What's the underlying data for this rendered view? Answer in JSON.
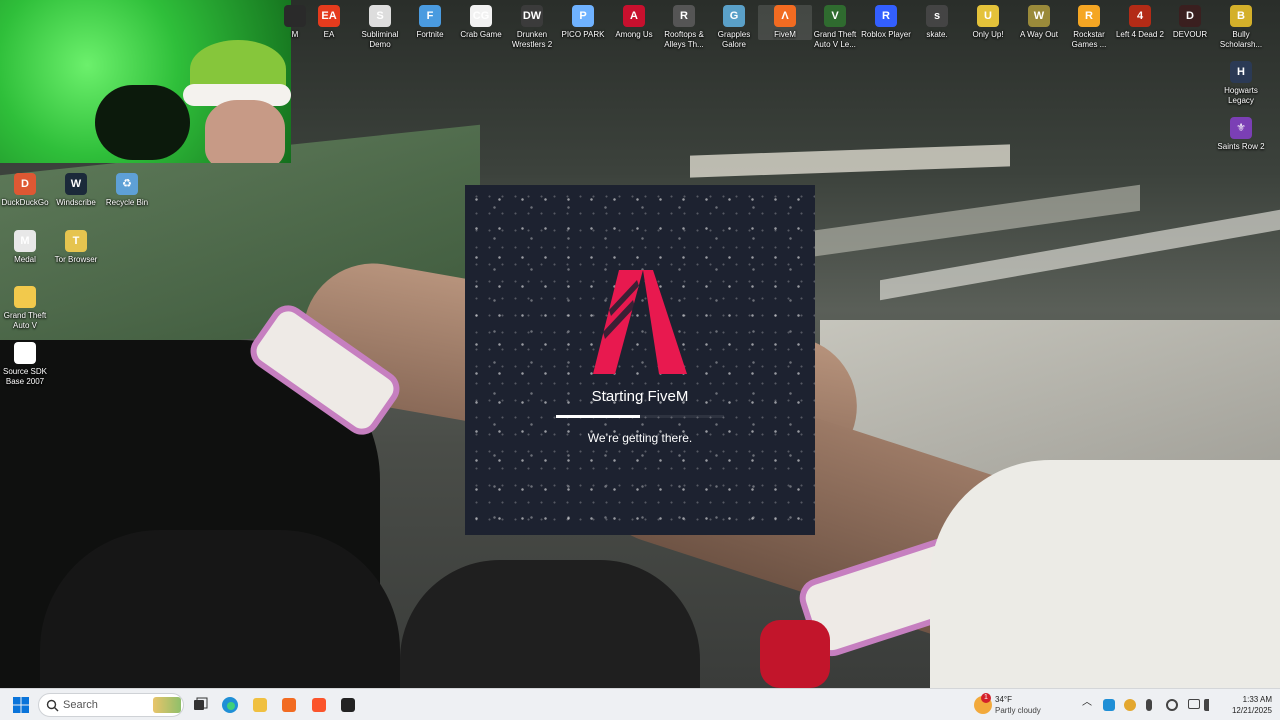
{
  "desktop": {
    "top_icons": [
      {
        "label": "M",
        "icon": "partial-app-icon",
        "color": "#2a2a2a",
        "glyph": ""
      },
      {
        "label": "EA",
        "icon": "ea-icon",
        "color": "#e53b1d",
        "glyph": "EA"
      },
      {
        "label": "Subliminal Demo",
        "icon": "subliminal-icon",
        "color": "#dddddd",
        "glyph": "S"
      },
      {
        "label": "Fortnite",
        "icon": "fortnite-icon",
        "color": "#4a9be0",
        "glyph": "F"
      },
      {
        "label": "Crab Game",
        "icon": "crab-game-icon",
        "color": "#f2f2f2",
        "glyph": "CG"
      },
      {
        "label": "Drunken Wrestlers 2",
        "icon": "drunken-wrestlers-icon",
        "color": "#3b3b3b",
        "glyph": "DW"
      },
      {
        "label": "PICO PARK",
        "icon": "pico-park-icon",
        "color": "#6fb2ff",
        "glyph": "P"
      },
      {
        "label": "Among Us",
        "icon": "among-us-icon",
        "color": "#c8102e",
        "glyph": "A"
      },
      {
        "label": "Rooftops & Alleys Th...",
        "icon": "rooftops-alleys-icon",
        "color": "#555555",
        "glyph": "R"
      },
      {
        "label": "Grapples Galore",
        "icon": "grapples-galore-icon",
        "color": "#5aa0c8",
        "glyph": "G"
      },
      {
        "label": "FiveM",
        "icon": "fivem-icon",
        "color": "#f26b21",
        "glyph": "Λ"
      },
      {
        "label": "Grand Theft Auto V Le...",
        "icon": "gta-v-legacy-icon",
        "color": "#2f6b2f",
        "glyph": "V"
      },
      {
        "label": "Roblox Player",
        "icon": "roblox-icon",
        "color": "#335fff",
        "glyph": "R"
      },
      {
        "label": "skate.",
        "icon": "skate-icon",
        "color": "#444444",
        "glyph": "s"
      },
      {
        "label": "Only Up!",
        "icon": "only-up-icon",
        "color": "#e4c23a",
        "glyph": "U"
      },
      {
        "label": "A Way Out",
        "icon": "a-way-out-icon",
        "color": "#9a8a3a",
        "glyph": "W"
      },
      {
        "label": "Rockstar Games ...",
        "icon": "rockstar-icon",
        "color": "#f5a623",
        "glyph": "R"
      },
      {
        "label": "Left 4 Dead 2",
        "icon": "left-4-dead-2-icon",
        "color": "#b32b16",
        "glyph": "4"
      },
      {
        "label": "DEVOUR",
        "icon": "devour-icon",
        "color": "#3a1f1f",
        "glyph": "D"
      },
      {
        "label": "Bully Scholarsh...",
        "icon": "bully-icon",
        "color": "#d4b02a",
        "glyph": "B"
      }
    ],
    "right_icons": [
      {
        "label": "Hogwarts Legacy",
        "icon": "hogwarts-legacy-icon",
        "color": "#2b3a55",
        "glyph": "H"
      },
      {
        "label": "Saints Row 2",
        "icon": "saints-row-2-icon",
        "color": "#7b3fb5",
        "glyph": "⚜"
      }
    ],
    "left_icons": [
      {
        "label": "DuckDuckGo",
        "icon": "duckduckgo-icon",
        "color": "#de5833",
        "glyph": "D"
      },
      {
        "label": "Windscribe",
        "icon": "windscribe-icon",
        "color": "#1b2a3a",
        "glyph": "W"
      },
      {
        "label": "Recycle Bin",
        "icon": "recycle-bin-icon",
        "color": "#5ea0d6",
        "glyph": "♻"
      },
      {
        "label": "Medal",
        "icon": "medal-icon",
        "color": "#e8e8e8",
        "glyph": "M"
      },
      {
        "label": "Tor Browser",
        "icon": "tor-browser-icon",
        "color": "#e6c44f",
        "glyph": "T"
      },
      {
        "label": "Grand Theft Auto V",
        "icon": "folder-icon",
        "color": "#f2c94c",
        "glyph": ""
      },
      {
        "label": "Source SDK Base 2007",
        "icon": "file-icon",
        "color": "#ffffff",
        "glyph": ""
      }
    ]
  },
  "splash": {
    "title": "Starting FiveM",
    "subtitle": "We’re getting there.",
    "progress": 0.5,
    "accent": "#e8194f"
  },
  "taskbar": {
    "search_placeholder": "Search",
    "pinned": [
      {
        "name": "file-explorer-icon",
        "color": "#f0c040"
      },
      {
        "name": "fivem-taskbar-icon",
        "color": "#f26b21"
      },
      {
        "name": "brave-icon",
        "color": "#fb542b"
      },
      {
        "name": "app-taskbar-icon",
        "color": "#222222"
      }
    ],
    "weather": {
      "badge": "1",
      "temp": "34°F",
      "condition": "Partly cloudy"
    },
    "clock": {
      "time": "1:33 AM",
      "date": "12/21/2025"
    }
  }
}
